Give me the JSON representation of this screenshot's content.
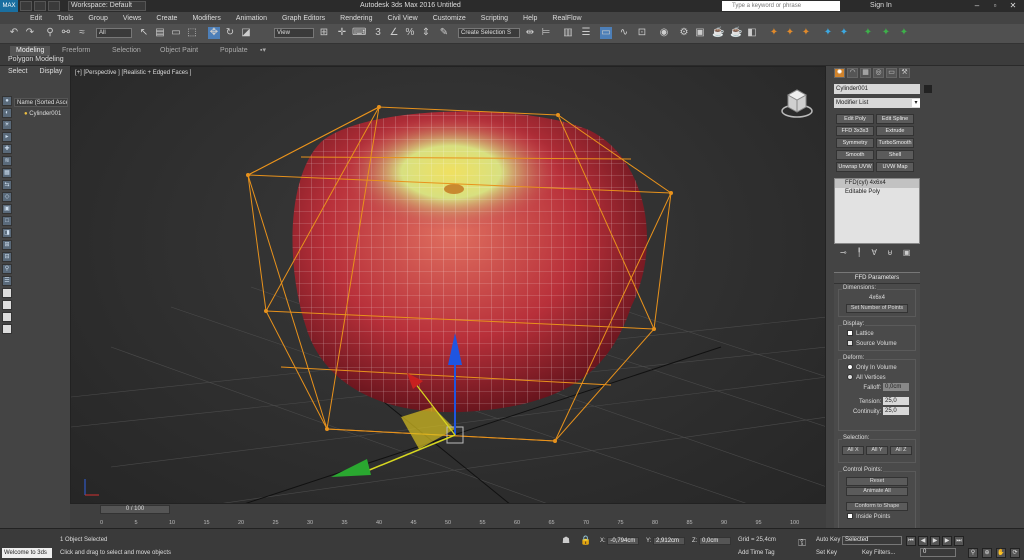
{
  "titlebar": {
    "logo": "MAX",
    "workspace": "Workspace: Default",
    "app_title": "Autodesk 3ds Max 2016     Untitled",
    "search_placeholder": "Type a keyword or phrase",
    "sign_in": "Sign In"
  },
  "menu": [
    "Edit",
    "Tools",
    "Group",
    "Views",
    "Create",
    "Modifiers",
    "Animation",
    "Graph Editors",
    "Rendering",
    "Civil View",
    "Customize",
    "Scripting",
    "Help",
    "RealFlow"
  ],
  "toolbar": {
    "filter": "All",
    "ref_coord": "View",
    "selection_set": "Create Selection S"
  },
  "ribbon": {
    "tabs": [
      "Modeling",
      "Freeform",
      "Selection",
      "Object Paint",
      "Populate"
    ],
    "active_tab": "Modeling",
    "sub": "Polygon Modeling"
  },
  "scene_explorer": {
    "tabs": [
      "Select",
      "Display"
    ],
    "column_header": "Name (Sorted Ascen",
    "item": "Cylinder001"
  },
  "viewport": {
    "label": "[+] [Perspective ] [Realistic + Edged Faces ]"
  },
  "command_panel": {
    "object_name": "Cylinder001",
    "modifier_list": "Modifier List",
    "modifier_buttons": [
      "Edit Poly",
      "Edit Spline",
      "FFD 3x3x3",
      "Extrude",
      "Symmetry",
      "TurboSmooth",
      "Smooth",
      "Shell",
      "Unwrap UVW",
      "UVW Map"
    ],
    "stack": [
      "FFD(cyl) 4x6x4",
      "Editable Poly"
    ],
    "ffd": {
      "title": "FFD Parameters",
      "dimensions_label": "Dimensions:",
      "dimensions": "4x6x4",
      "set_points": "Set Number of Points",
      "display_label": "Display:",
      "lattice": "Lattice",
      "source_volume": "Source Volume",
      "deform_label": "Deform:",
      "only_in_volume": "Only In Volume",
      "all_vertices": "All Vertices",
      "falloff_label": "Falloff:",
      "falloff": "0,0cm",
      "tension_label": "Tension:",
      "tension": "25,0",
      "continuity_label": "Continuity:",
      "continuity": "25,0",
      "selection_label": "Selection:",
      "all_x": "All X",
      "all_y": "All Y",
      "all_z": "All Z",
      "control_points_label": "Control Points:",
      "reset": "Reset",
      "animate_all": "Animate All",
      "conform": "Conform to Shape",
      "inside_points": "Inside Points"
    }
  },
  "timeline": {
    "frame": "0 / 100",
    "ticks": [
      "0",
      "5",
      "10",
      "15",
      "20",
      "25",
      "30",
      "35",
      "40",
      "45",
      "50",
      "55",
      "60",
      "65",
      "70",
      "75",
      "80",
      "85",
      "90",
      "95",
      "100"
    ]
  },
  "status": {
    "maxscript": "Welcome to 3ds",
    "selected": "1 Object Selected",
    "prompt": "Click and drag to select and move objects",
    "x_label": "X:",
    "x": "-0,794cm",
    "y_label": "Y:",
    "y": "2,912cm",
    "z_label": "Z:",
    "z": "0,0cm",
    "grid": "Grid = 25,4cm",
    "add_time_tag": "Add Time Tag",
    "auto_key": "Auto Key",
    "set_key": "Set Key",
    "selected_dropdown": "Selected",
    "key_filters": "Key Filters...",
    "current_frame": "0"
  }
}
